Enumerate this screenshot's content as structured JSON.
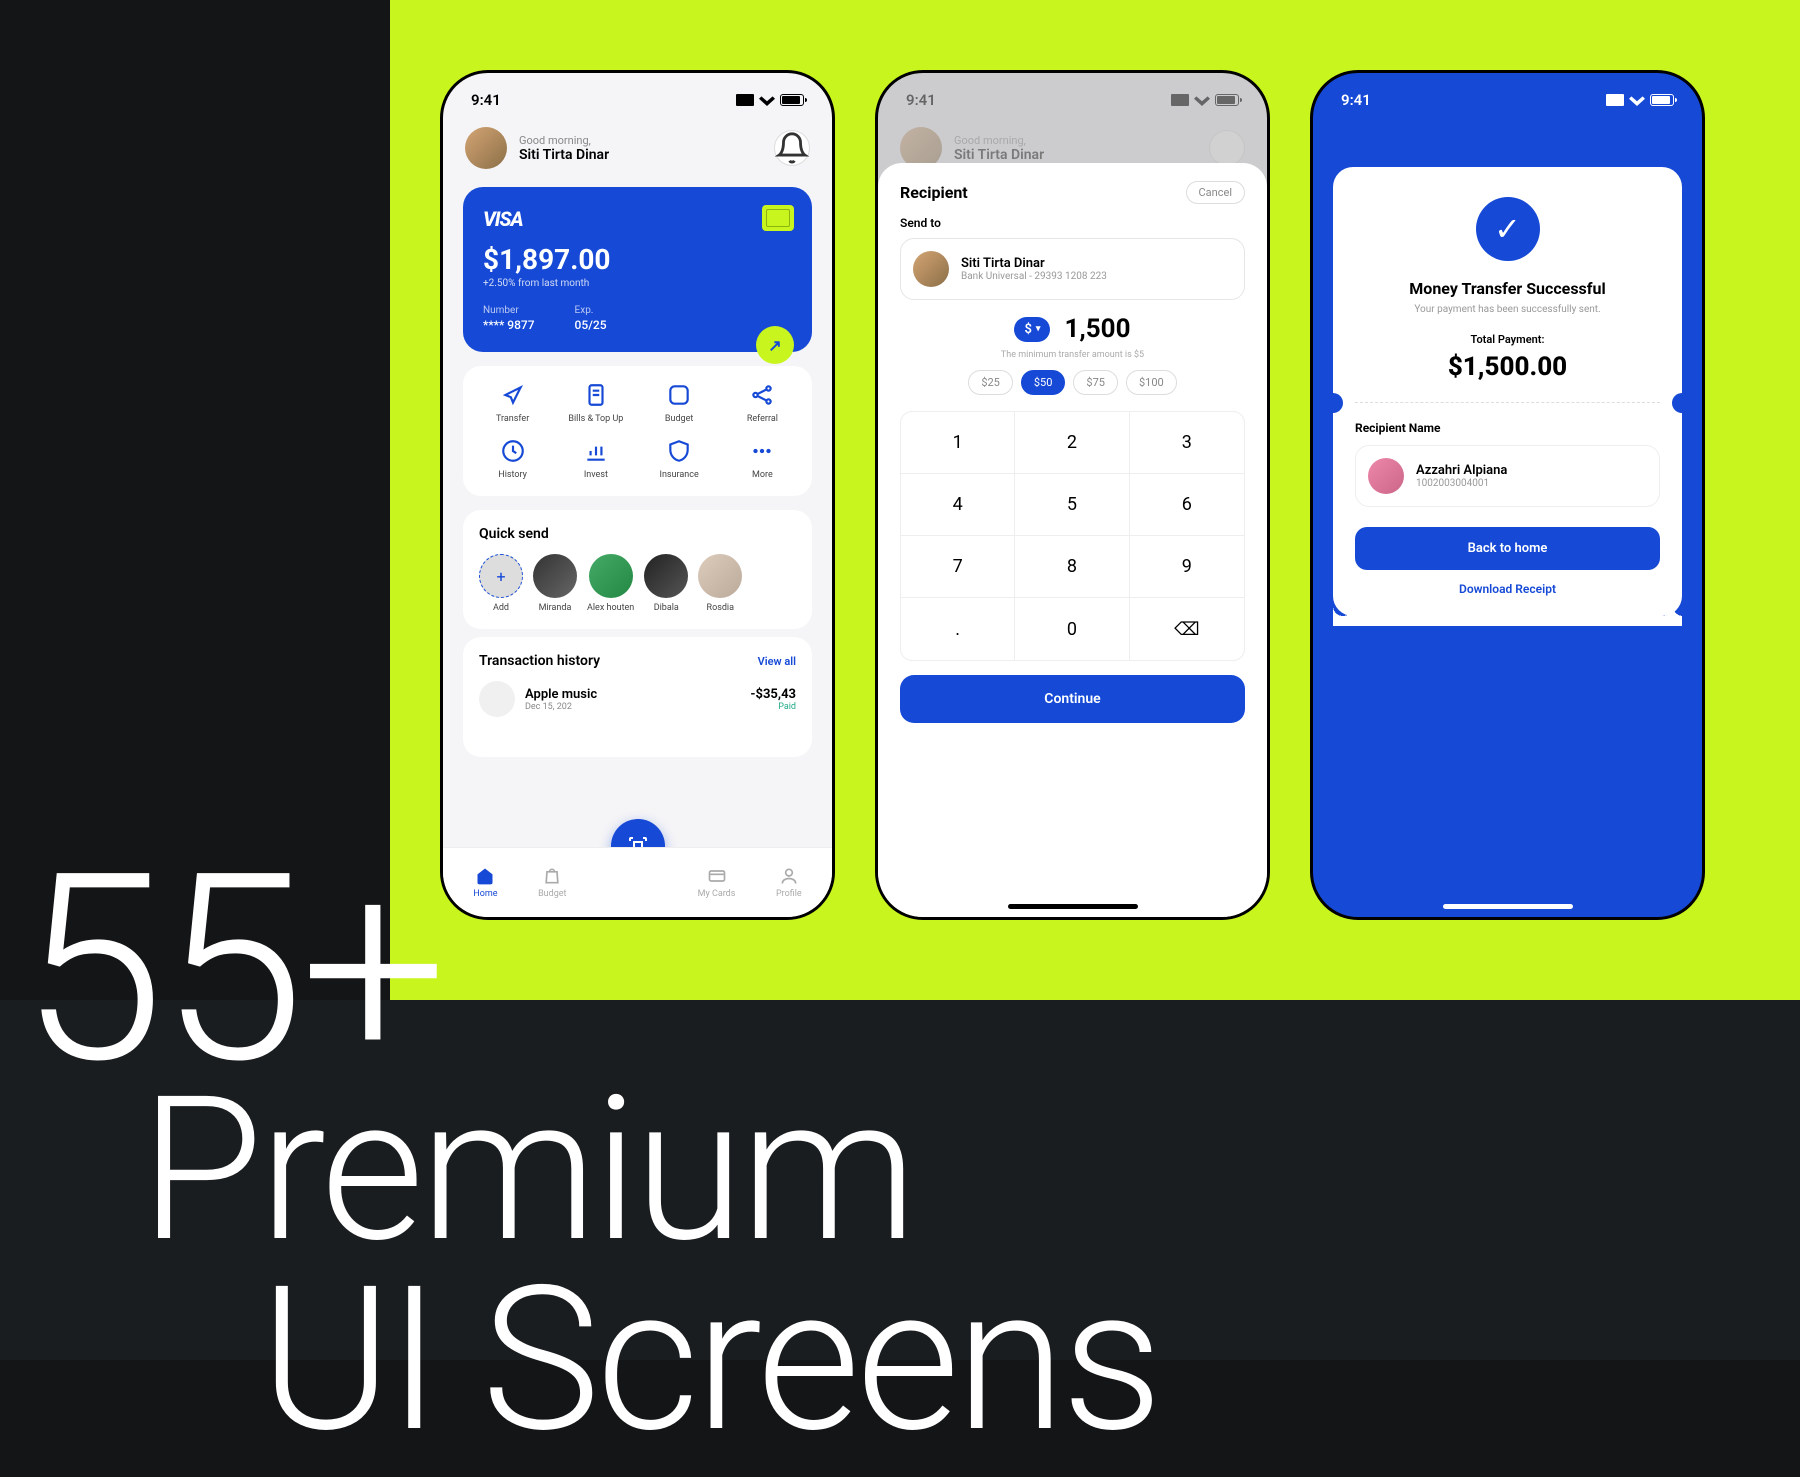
{
  "headline": {
    "line1": "55+",
    "line2": "Premium",
    "line3": "UI Screens"
  },
  "status": {
    "time": "9:41"
  },
  "phone1": {
    "greeting": "Good morning,",
    "name": "Siti Tirta Dinar",
    "card": {
      "brand": "VISA",
      "balance": "$1,897.00",
      "delta": "+2.50% from last month",
      "num_label": "Number",
      "num": "**** 9877",
      "exp_label": "Exp.",
      "exp": "05/25"
    },
    "actions": [
      "Transfer",
      "Bills & Top Up",
      "Budget",
      "Referral",
      "History",
      "Invest",
      "Insurance",
      "More"
    ],
    "quicksend": {
      "title": "Quick send",
      "add": "Add",
      "contacts": [
        "Miranda",
        "Alex houten",
        "Dibala",
        "Rosdia"
      ]
    },
    "trans": {
      "title": "Transaction history",
      "viewall": "View all",
      "item": {
        "name": "Apple music",
        "date": "Dec 15, 202",
        "amount": "-$35,43",
        "status": "Paid"
      }
    },
    "tabs": [
      "Home",
      "Budget",
      "",
      "My Cards",
      "Profile"
    ]
  },
  "phone2": {
    "title": "Recipient",
    "cancel": "Cancel",
    "sendto": "Send to",
    "rec": {
      "name": "Siti Tirta Dinar",
      "bank": "Bank Universal - 29393 1208 223"
    },
    "currency": "$",
    "amount": "1,500",
    "min": "The minimum transfer amount is $5",
    "chips": [
      "$25",
      "$50",
      "$75",
      "$100"
    ],
    "keys": [
      "1",
      "2",
      "3",
      "4",
      "5",
      "6",
      "7",
      "8",
      "9",
      ".",
      "0",
      "⌫"
    ],
    "continue": "Continue"
  },
  "phone3": {
    "title": "Money Transfer Successful",
    "sub": "Your payment has been successfully sent.",
    "total_lbl": "Total Payment:",
    "total": "$1,500.00",
    "rec_title": "Recipient Name",
    "rec": {
      "name": "Azzahri Alpiana",
      "acct": "1002003004001"
    },
    "back": "Back to home",
    "download": "Download Receipt"
  }
}
